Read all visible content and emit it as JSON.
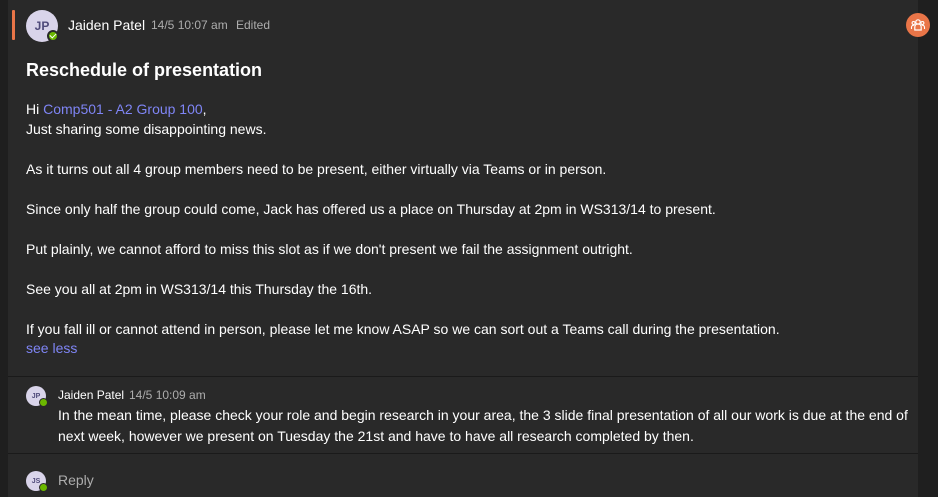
{
  "post": {
    "author": "Jaiden Patel",
    "initials": "JP",
    "timestamp": "14/5 10:07 am",
    "edited": "Edited",
    "subject": "Reschedule of presentation",
    "greeting_prefix": "Hi ",
    "mention": "Comp501 - A2 Group 100",
    "greeting_suffix": ",",
    "lines": [
      "Just sharing some disappointing news.",
      "As it turns out all 4 group members need to be present, either virtually via Teams or in person.",
      "Since only half the group could come, Jack has offered us a place on Thursday at 2pm in WS313/14 to present.",
      "Put plainly, we cannot afford to miss this slot as if we don't present we fail the assignment outright.",
      "See you all at 2pm in WS313/14 this Thursday the 16th.",
      "If you fall ill or cannot attend in person, please let me know ASAP so we can sort out a Teams call during the presentation."
    ],
    "see_less": "see less"
  },
  "reply": {
    "author": "Jaiden Patel",
    "initials": "JP",
    "timestamp": "14/5 10:09 am",
    "text": "In the mean time, please check your role and begin research in your area, the 3 slide final presentation of all our work is due at the end of next week, however we present on Tuesday the 21st and have to have all research completed by then."
  },
  "composer": {
    "initials": "JS",
    "placeholder": "Reply"
  },
  "colors": {
    "accent": "#e97548",
    "mention": "#7f85f5",
    "presence": "#6bb700"
  },
  "icons": {
    "corner": "team-icon"
  }
}
